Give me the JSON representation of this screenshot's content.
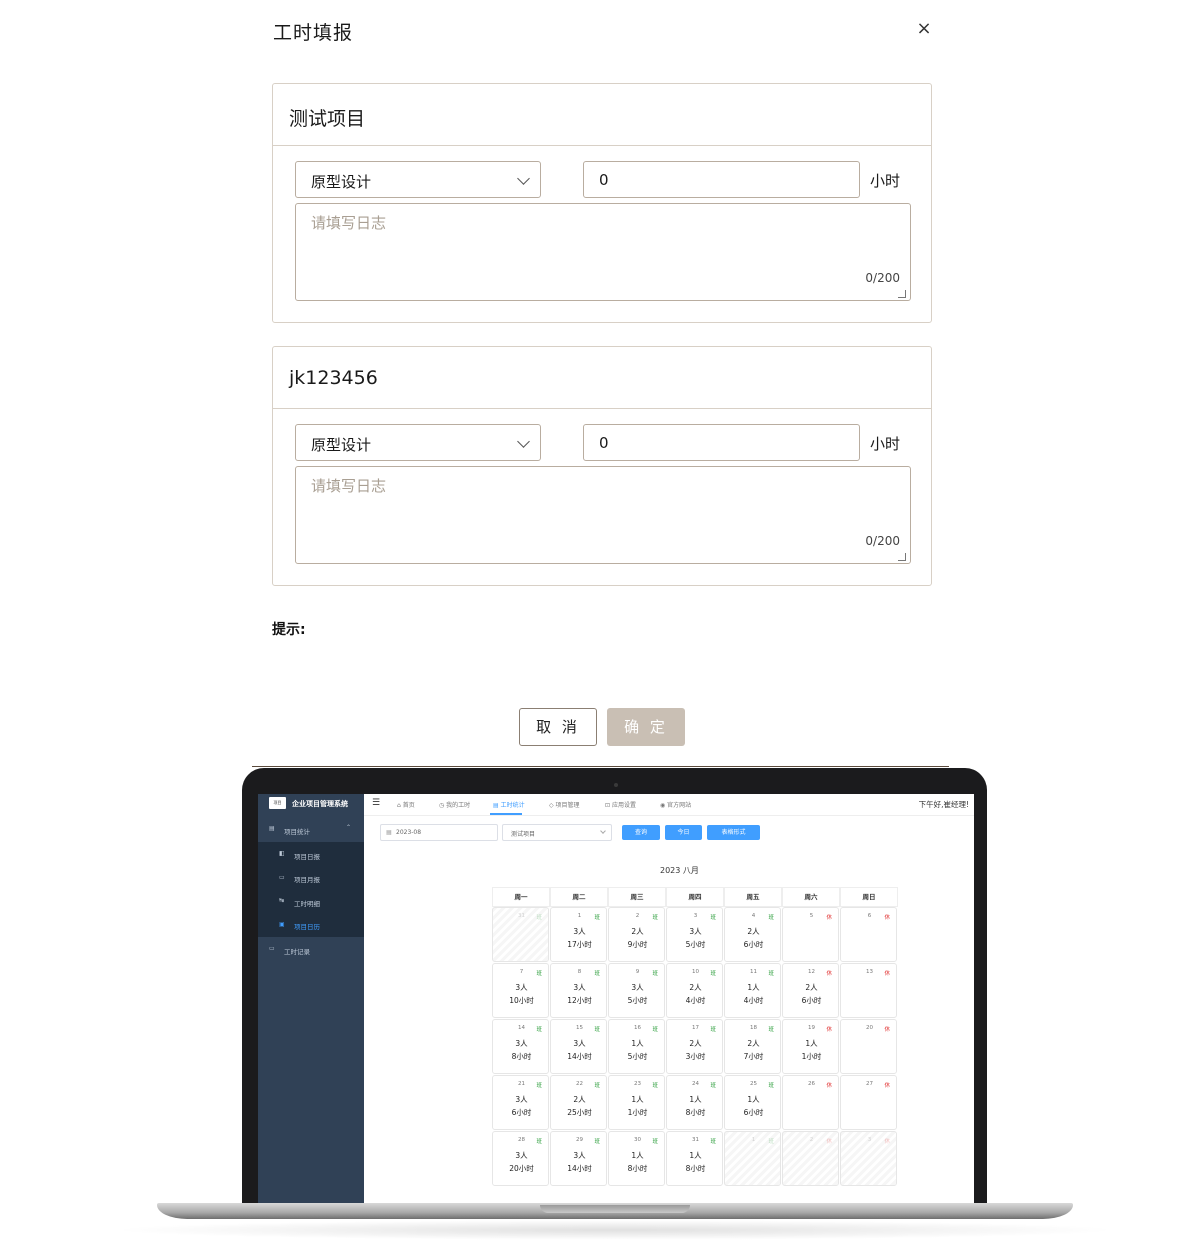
{
  "dialog": {
    "title": "工时填报",
    "close_glyph": "×",
    "entries": [
      {
        "project": "测试项目",
        "task_type": "原型设计",
        "hours": "0",
        "unit": "小时",
        "log_placeholder": "请填写日志",
        "counter": "0/200"
      },
      {
        "project": "jk123456",
        "task_type": "原型设计",
        "hours": "0",
        "unit": "小时",
        "log_placeholder": "请填写日志",
        "counter": "0/200"
      }
    ],
    "hint_label": "提示:",
    "cancel_label": "取 消",
    "confirm_label": "确 定"
  },
  "colors": {
    "primary": "#409eff",
    "sidebar_bg": "#304156",
    "workday_tag": "#2a9d3a",
    "rest_tag": "#e03030",
    "confirm_bg": "#c9bfb4"
  },
  "app": {
    "logo_text": "项目",
    "system_title": "企业项目管理系统",
    "sidebar": {
      "group_label": "项目统计",
      "items": [
        "项目日报",
        "项目月报",
        "工时明细",
        "项目日历"
      ],
      "active_item": "项目日历",
      "bottom_item": "工时记录"
    },
    "topnav": {
      "items": [
        "首页",
        "我的工时",
        "工时统计",
        "项目管理",
        "应用设置",
        "官方网站"
      ],
      "active": "工时统计"
    },
    "greeting": "下午好,崔经理!",
    "filters": {
      "month": "2023-08",
      "project": "测试项目",
      "buttons": [
        "查询",
        "今日",
        "表格形式"
      ]
    },
    "calendar": {
      "title": "2023 八月",
      "weekdays": [
        "周一",
        "周二",
        "周三",
        "周四",
        "周五",
        "周六",
        "周日"
      ],
      "cells": [
        {
          "day": "31",
          "tag": "班",
          "people": "",
          "hours": "",
          "other": true
        },
        {
          "day": "1",
          "tag": "班",
          "people": "3人",
          "hours": "17小时",
          "other": false
        },
        {
          "day": "2",
          "tag": "班",
          "people": "2人",
          "hours": "9小时",
          "other": false
        },
        {
          "day": "3",
          "tag": "班",
          "people": "3人",
          "hours": "5小时",
          "other": false
        },
        {
          "day": "4",
          "tag": "班",
          "people": "2人",
          "hours": "6小时",
          "other": false
        },
        {
          "day": "5",
          "tag": "休",
          "people": "",
          "hours": "",
          "other": false
        },
        {
          "day": "6",
          "tag": "休",
          "people": "",
          "hours": "",
          "other": false
        },
        {
          "day": "7",
          "tag": "班",
          "people": "3人",
          "hours": "10小时",
          "other": false
        },
        {
          "day": "8",
          "tag": "班",
          "people": "3人",
          "hours": "12小时",
          "other": false
        },
        {
          "day": "9",
          "tag": "班",
          "people": "3人",
          "hours": "5小时",
          "other": false
        },
        {
          "day": "10",
          "tag": "班",
          "people": "2人",
          "hours": "4小时",
          "other": false
        },
        {
          "day": "11",
          "tag": "班",
          "people": "1人",
          "hours": "4小时",
          "other": false
        },
        {
          "day": "12",
          "tag": "休",
          "people": "2人",
          "hours": "6小时",
          "other": false
        },
        {
          "day": "13",
          "tag": "休",
          "people": "",
          "hours": "",
          "other": false
        },
        {
          "day": "14",
          "tag": "班",
          "people": "3人",
          "hours": "8小时",
          "other": false
        },
        {
          "day": "15",
          "tag": "班",
          "people": "3人",
          "hours": "14小时",
          "other": false
        },
        {
          "day": "16",
          "tag": "班",
          "people": "1人",
          "hours": "5小时",
          "other": false
        },
        {
          "day": "17",
          "tag": "班",
          "people": "2人",
          "hours": "3小时",
          "other": false
        },
        {
          "day": "18",
          "tag": "班",
          "people": "2人",
          "hours": "7小时",
          "other": false
        },
        {
          "day": "19",
          "tag": "休",
          "people": "1人",
          "hours": "1小时",
          "other": false
        },
        {
          "day": "20",
          "tag": "休",
          "people": "",
          "hours": "",
          "other": false
        },
        {
          "day": "21",
          "tag": "班",
          "people": "3人",
          "hours": "6小时",
          "other": false
        },
        {
          "day": "22",
          "tag": "班",
          "people": "2人",
          "hours": "25小时",
          "other": false
        },
        {
          "day": "23",
          "tag": "班",
          "people": "1人",
          "hours": "1小时",
          "other": false
        },
        {
          "day": "24",
          "tag": "班",
          "people": "1人",
          "hours": "8小时",
          "other": false
        },
        {
          "day": "25",
          "tag": "班",
          "people": "1人",
          "hours": "6小时",
          "other": false
        },
        {
          "day": "26",
          "tag": "休",
          "people": "",
          "hours": "",
          "other": false
        },
        {
          "day": "27",
          "tag": "休",
          "people": "",
          "hours": "",
          "other": false
        },
        {
          "day": "28",
          "tag": "班",
          "people": "3人",
          "hours": "20小时",
          "other": false
        },
        {
          "day": "29",
          "tag": "班",
          "people": "3人",
          "hours": "14小时",
          "other": false
        },
        {
          "day": "30",
          "tag": "班",
          "people": "1人",
          "hours": "8小时",
          "other": false
        },
        {
          "day": "31",
          "tag": "班",
          "people": "1人",
          "hours": "8小时",
          "other": false
        },
        {
          "day": "1",
          "tag": "班",
          "people": "",
          "hours": "",
          "other": true
        },
        {
          "day": "2",
          "tag": "休",
          "people": "",
          "hours": "",
          "other": true
        },
        {
          "day": "3",
          "tag": "休",
          "people": "",
          "hours": "",
          "other": true
        }
      ]
    }
  }
}
